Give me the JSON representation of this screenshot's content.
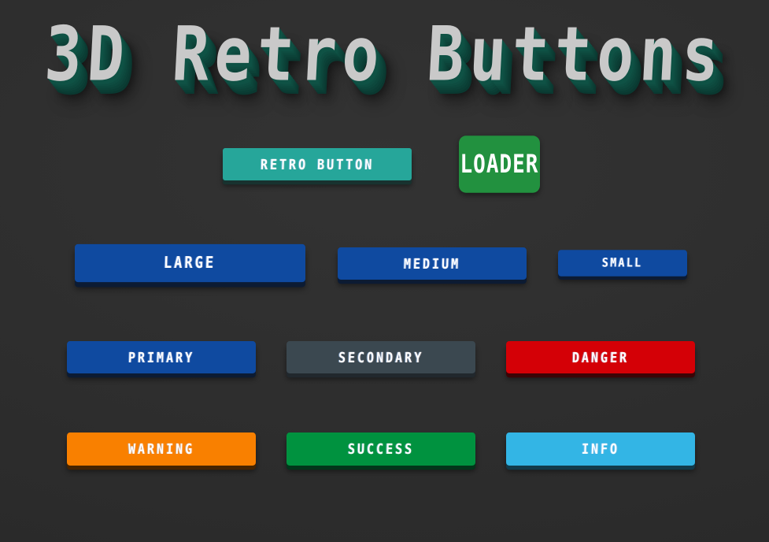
{
  "page": {
    "title": "3D Retro Buttons",
    "background_color": "#2e2e2e",
    "title_color": "#c9c9c9",
    "title_shadow_color": "#0f5245"
  },
  "rows": {
    "row1": {
      "retro": {
        "label": "RETRO BUTTON",
        "color": "#26a69a",
        "shadow": "#18322f"
      },
      "loader": {
        "label": "LOADER",
        "color": "#22913f",
        "shadow": "#0f5022"
      }
    },
    "row2_sizes": {
      "large": {
        "label": "LARGE",
        "color": "#0f4aa0",
        "shadow": "#0c1b33"
      },
      "medium": {
        "label": "MEDIUM",
        "color": "#0f4aa0",
        "shadow": "#0c1b33"
      },
      "small": {
        "label": "SMALL",
        "color": "#0f4aa0",
        "shadow": "#0c1b33"
      }
    },
    "row3_variants": {
      "primary": {
        "label": "PRIMARY",
        "color": "#0f4aa0",
        "shadow": "#0c1b33"
      },
      "secondary": {
        "label": "SECONDARY",
        "color": "#3b4850",
        "shadow": "#21282d"
      },
      "danger": {
        "label": "DANGER",
        "color": "#d40006",
        "shadow": "#3c0406"
      }
    },
    "row4_variants": {
      "warning": {
        "label": "WARNING",
        "color": "#f98000",
        "shadow": "#452400"
      },
      "success": {
        "label": "SUCCESS",
        "color": "#00923f",
        "shadow": "#02361a"
      },
      "info": {
        "label": "INFO",
        "color": "#33b5e5",
        "shadow": "#123a4a"
      }
    }
  }
}
